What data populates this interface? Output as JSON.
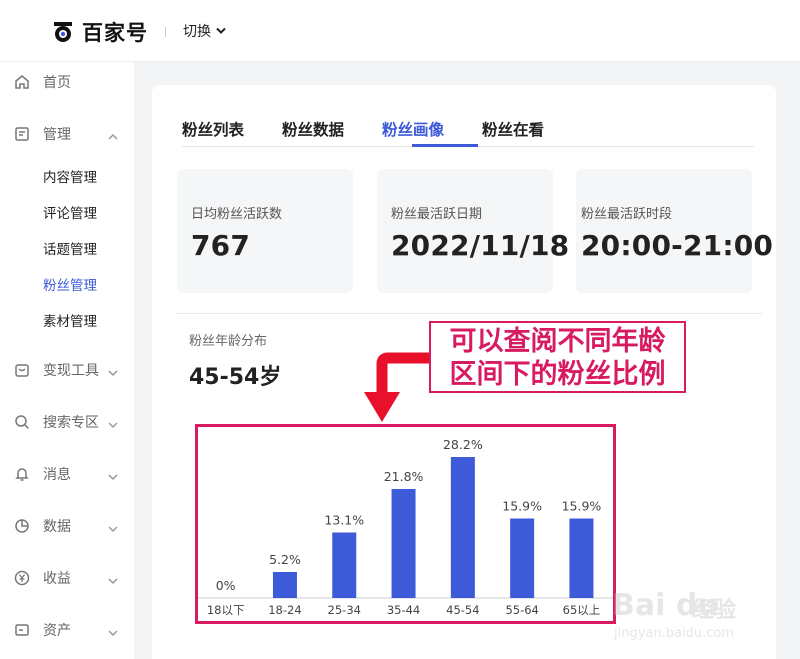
{
  "header": {
    "logo_text": "百家号",
    "switch_label": "切换"
  },
  "sidebar": {
    "items": [
      {
        "label": "首页",
        "icon": "home-icon"
      },
      {
        "label": "管理",
        "icon": "document-icon"
      },
      {
        "label": "变现工具",
        "icon": "wallet-icon"
      },
      {
        "label": "搜索专区",
        "icon": "search-icon"
      },
      {
        "label": "消息",
        "icon": "bell-icon"
      },
      {
        "label": "数据",
        "icon": "pie-chart-icon"
      },
      {
        "label": "收益",
        "icon": "yen-icon"
      },
      {
        "label": "资产",
        "icon": "card-icon"
      }
    ],
    "sub_items": [
      "内容管理",
      "评论管理",
      "话题管理",
      "粉丝管理",
      "素材管理"
    ],
    "active_sub": "粉丝管理"
  },
  "tabs": [
    "粉丝列表",
    "粉丝数据",
    "粉丝画像",
    "粉丝在看"
  ],
  "active_tab": "粉丝画像",
  "stats": [
    {
      "label": "日均粉丝活跃数",
      "value": "767"
    },
    {
      "label": "粉丝最活跃日期",
      "value": "2022/11/18"
    },
    {
      "label": "粉丝最活跃时段",
      "value": "20:00-21:00"
    }
  ],
  "age": {
    "label": "粉丝年龄分布",
    "value": "45-54岁"
  },
  "annotation": {
    "line1": "可以查阅不同年龄",
    "line2": "区间下的粉丝比例"
  },
  "watermark": {
    "brand": "Bai du",
    "jingyan": "经验",
    "url": "jingyan.baidu.com"
  },
  "colors": {
    "accent": "#3d5ad8",
    "annotation": "#d81b60"
  },
  "chart_data": {
    "type": "bar",
    "categories": [
      "18以下",
      "18-24",
      "25-34",
      "35-44",
      "45-54",
      "55-64",
      "65以上"
    ],
    "values": [
      0,
      5.2,
      13.1,
      21.8,
      28.2,
      15.9,
      15.9
    ],
    "value_labels": [
      "0%",
      "5.2%",
      "13.1%",
      "21.8%",
      "28.2%",
      "15.9%",
      "15.9%"
    ],
    "ylim": [
      0,
      30
    ],
    "color": "#3d5ad8"
  }
}
